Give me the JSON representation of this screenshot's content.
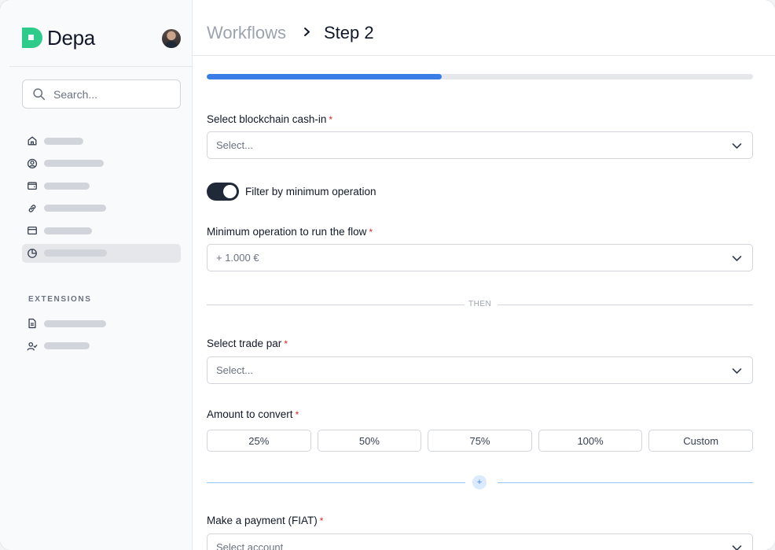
{
  "app": {
    "name": "Depa"
  },
  "search": {
    "placeholder": "Search..."
  },
  "sidebar": {
    "items": [
      {
        "icon": "home-icon"
      },
      {
        "icon": "user-circle-icon"
      },
      {
        "icon": "wallet-icon"
      },
      {
        "icon": "link-icon"
      },
      {
        "icon": "card-icon"
      },
      {
        "icon": "pie-chart-icon",
        "active": true
      }
    ],
    "extensions_label": "EXTENSIONS",
    "extension_items": [
      {
        "icon": "document-icon"
      },
      {
        "icon": "user-check-icon"
      }
    ]
  },
  "header": {
    "breadcrumb_root": "Workflows",
    "breadcrumb_current": "Step 2"
  },
  "progress": {
    "value": 0.43,
    "color": "#3b7de6"
  },
  "form": {
    "cashin": {
      "label": "Select blockchain cash-in",
      "required_mark": "*",
      "placeholder": "Select..."
    },
    "filter_toggle": {
      "label": "Filter by minimum operation",
      "on": true
    },
    "min_operation": {
      "label": "Minimum operation to run the flow",
      "required_mark": "*",
      "value": "+ 1.000 €"
    },
    "divider_text": "THEN",
    "trade_pair": {
      "label": "Select trade par",
      "required_mark": "*",
      "placeholder": "Select..."
    },
    "amount": {
      "label": "Amount to convert",
      "required_mark": "*",
      "options": [
        "25%",
        "50%",
        "75%",
        "100%",
        "Custom"
      ]
    },
    "add_step": {
      "symbol": "+"
    },
    "payment": {
      "label": "Make a payment (FIAT)",
      "required_mark": "*",
      "placeholder": "Select account"
    }
  },
  "colors": {
    "brand_green": "#2ecc8a",
    "accent_blue": "#3b7de6",
    "required_red": "#dc2626"
  }
}
